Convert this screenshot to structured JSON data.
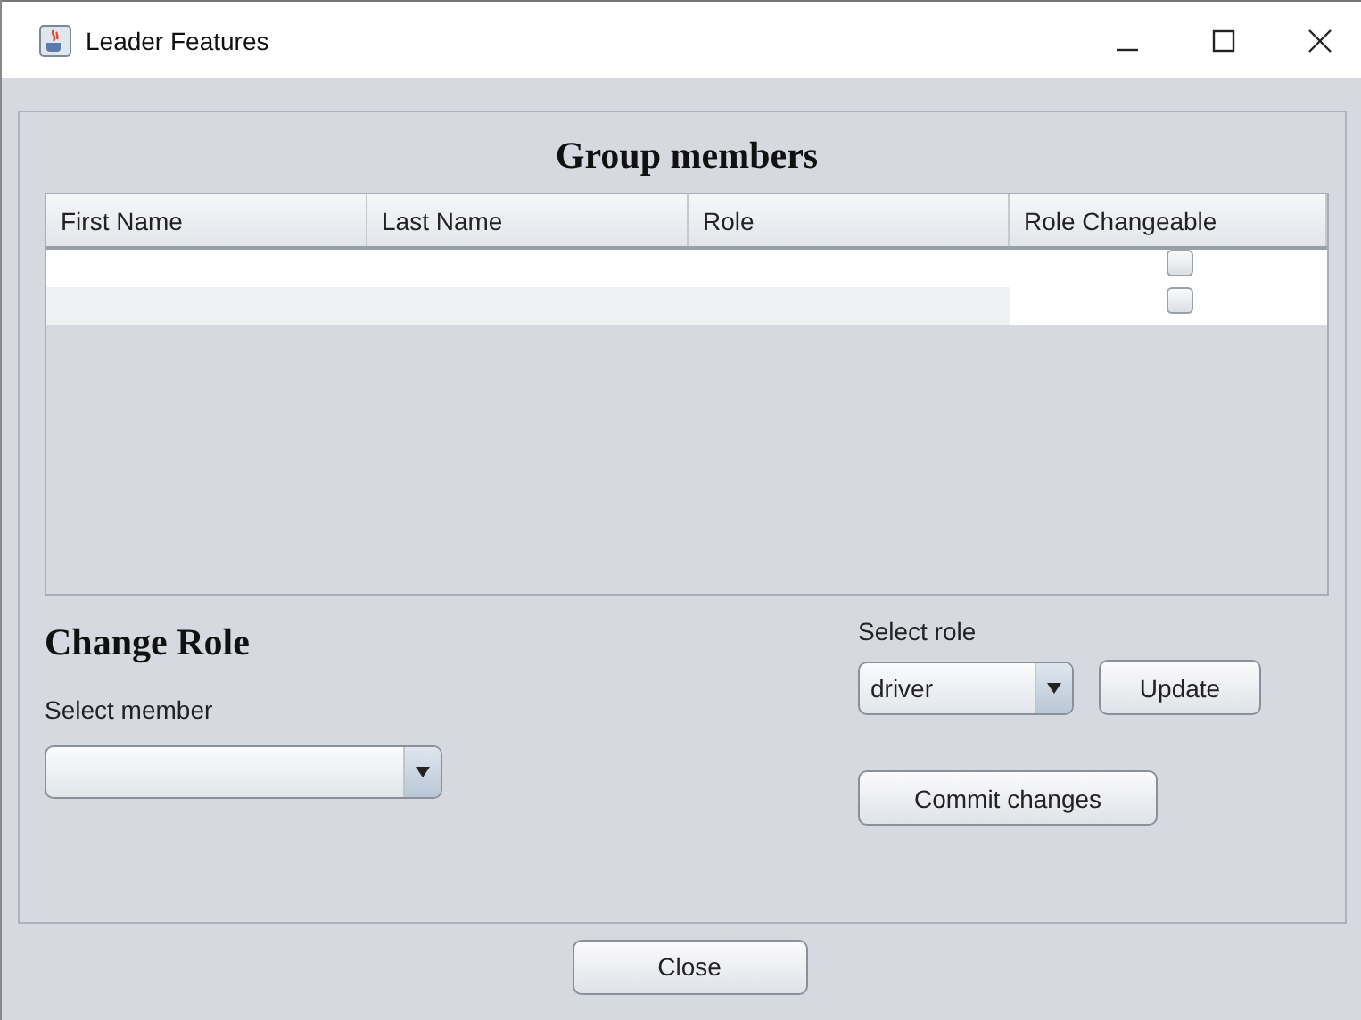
{
  "window": {
    "title": "Leader Features"
  },
  "group_members": {
    "heading": "Group members",
    "columns": [
      "First Name",
      "Last Name",
      "Role",
      "Role Changeable"
    ],
    "rows": [
      {
        "role_changeable": false
      },
      {
        "role_changeable": false
      }
    ]
  },
  "change_role": {
    "heading": "Change Role",
    "member_label": "Select member",
    "role_label": "Select role",
    "role_value": "driver",
    "update_button": "Update",
    "commit_button": "Commit changes"
  },
  "close_button": "Close"
}
